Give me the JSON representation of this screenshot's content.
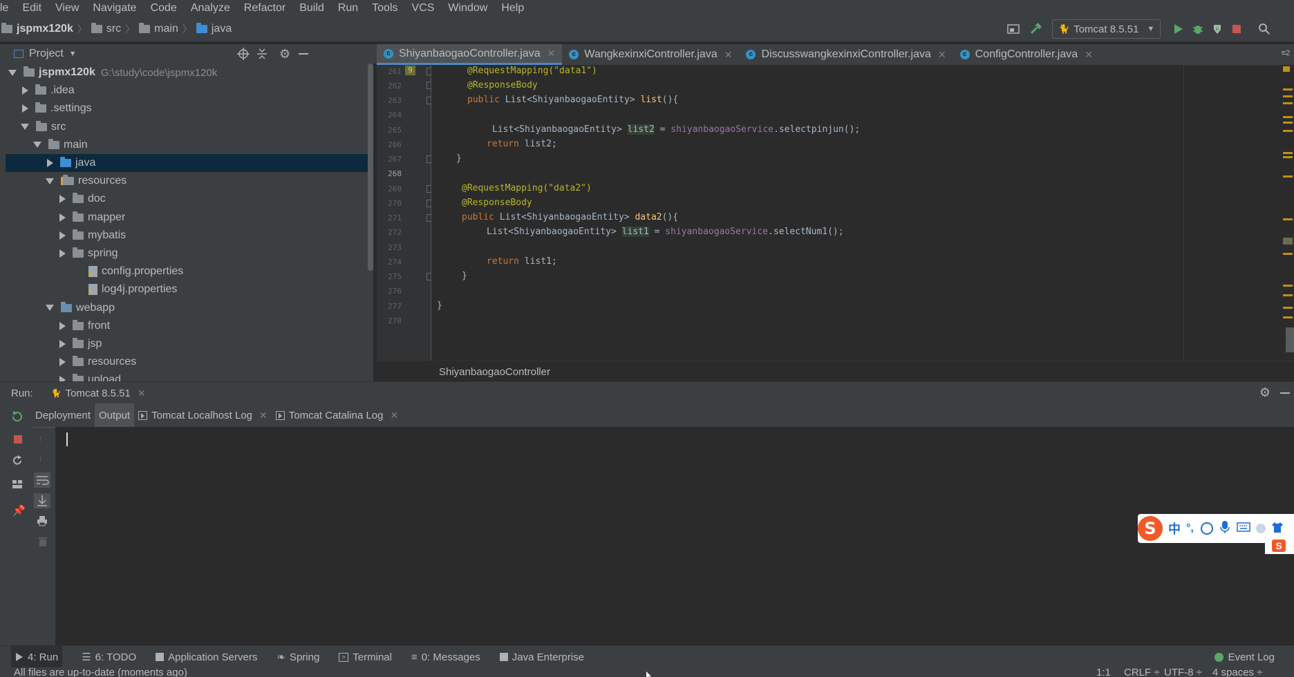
{
  "menu": [
    "le",
    "Edit",
    "View",
    "Navigate",
    "Code",
    "Analyze",
    "Refactor",
    "Build",
    "Run",
    "Tools",
    "VCS",
    "Window",
    "Help"
  ],
  "nav": {
    "project": "jspmx120k",
    "crumbs": [
      "src",
      "main",
      "java"
    ],
    "run_config": "Tomcat 8.5.51"
  },
  "project_panel": {
    "title": "Project",
    "root_name": "jspmx120k",
    "root_path": "G:\\study\\code\\jspmx120k",
    "items": [
      {
        "label": "jspmx120k"
      },
      {
        "label": ".idea"
      },
      {
        "label": ".settings"
      },
      {
        "label": "src"
      },
      {
        "label": "main"
      },
      {
        "label": "java"
      },
      {
        "label": "resources"
      },
      {
        "label": "doc"
      },
      {
        "label": "mapper"
      },
      {
        "label": "mybatis"
      },
      {
        "label": "spring"
      },
      {
        "label": "config.properties"
      },
      {
        "label": "log4j.properties"
      },
      {
        "label": "webapp"
      },
      {
        "label": "front"
      },
      {
        "label": "jsp"
      },
      {
        "label": "resources"
      },
      {
        "label": "upload"
      }
    ]
  },
  "editor": {
    "tabs": [
      {
        "label": "ShiyanbaogaoController.java"
      },
      {
        "label": "WangkexinxiController.java"
      },
      {
        "label": "DiscusswangkexinxiController.java"
      },
      {
        "label": "ConfigController.java"
      }
    ],
    "tab_overflow": "≡2",
    "gutter_badge": "9",
    "line_numbers": [
      "261",
      "262",
      "263",
      "264",
      "265",
      "266",
      "267",
      "268",
      "269",
      "270",
      "271",
      "272",
      "273",
      "274",
      "275",
      "276",
      "277",
      "278"
    ],
    "code": {
      "l261": "@RequestMapping(\"data1\")",
      "l262": "@ResponseBody",
      "l263_kw": "public",
      "l263_type": " List<ShiyanbaogaoEntity> ",
      "l263_m": "list",
      "l263_rest": "(){",
      "l265_type": "List<ShiyanbaogaoEntity> ",
      "l265_var": "list2",
      "l265_eq": " = ",
      "l265_fld": "shiyanbaogaoService",
      "l265_call": ".selectpinjun();",
      "l266_kw": "return",
      "l266_rest": " list2;",
      "l267": "}",
      "l269": "@RequestMapping(\"data2\")",
      "l270": "@ResponseBody",
      "l271_kw": "public",
      "l271_type": " List<ShiyanbaogaoEntity> ",
      "l271_m": "data2",
      "l271_rest": "(){",
      "l272_type": "List<ShiyanbaogaoEntity> ",
      "l272_var": "list1",
      "l272_eq": " = ",
      "l272_fld": "shiyanbaogaoService",
      "l272_call": ".selectNum1();",
      "l274_kw": "return",
      "l274_rest": " list1;",
      "l275": "}",
      "l277": "}"
    },
    "breadcrumb": "ShiyanbaogaoController"
  },
  "run_panel": {
    "label": "Run:",
    "config_tab": "Tomcat 8.5.51",
    "tabs": [
      {
        "label": "Deployment"
      },
      {
        "label": "Output"
      },
      {
        "label": "Tomcat Localhost Log"
      },
      {
        "label": "Tomcat Catalina Log"
      }
    ]
  },
  "bottom_tools": [
    {
      "label": "4: Run"
    },
    {
      "label": "6: TODO"
    },
    {
      "label": "Application Servers"
    },
    {
      "label": "Spring"
    },
    {
      "label": "Terminal"
    },
    {
      "label": "0: Messages"
    },
    {
      "label": "Java Enterprise"
    }
  ],
  "event_log": "Event Log",
  "status": {
    "message": "All files are up-to-date (moments ago)",
    "position": "1:1",
    "line_sep": "CRLF ÷",
    "encoding": "UTF-8 ÷",
    "indent": "4 spaces ÷"
  },
  "ime": {
    "lang": "中",
    "punct": "°,"
  },
  "colors": {
    "bg": "#2b2b2b",
    "panel": "#3c3f41",
    "selection": "#0d293e",
    "annotation": "#bbb529",
    "keyword": "#cc7832",
    "string": "#6a8759",
    "field": "#9876aa",
    "method": "#ffc66d"
  }
}
